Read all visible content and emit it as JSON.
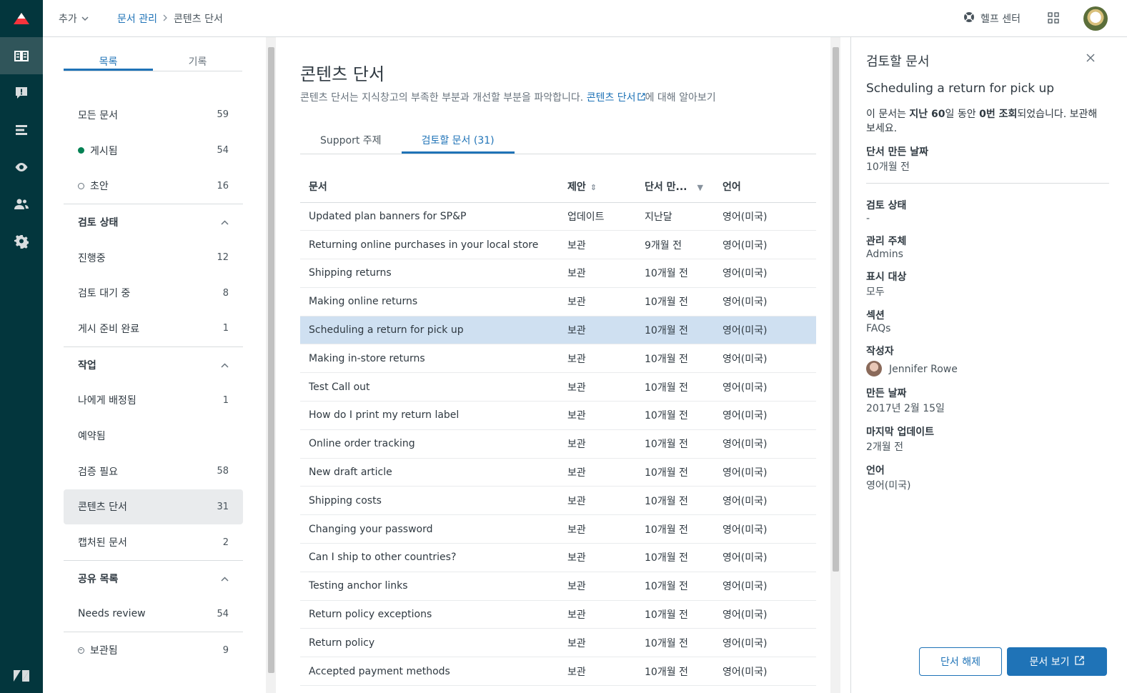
{
  "header": {
    "add_label": "추가",
    "breadcrumb": [
      "문서 관리",
      "콘텐츠 단서"
    ],
    "help_label": "헬프 센터"
  },
  "rail": {
    "icons": [
      "zendesk-guide-logo",
      "knowledge-icon",
      "alert-icon",
      "list-icon",
      "eye-icon",
      "users-icon",
      "gear-icon",
      "zendesk-logo"
    ]
  },
  "sidenav": {
    "tabs": [
      "목록",
      "기록"
    ],
    "top_items": [
      {
        "label": "모든 문서",
        "count": "59"
      },
      {
        "label": "게시됨",
        "count": "54"
      },
      {
        "label": "초안",
        "count": "16"
      }
    ],
    "review_head": "검토 상태",
    "review_items": [
      {
        "label": "진행중",
        "count": "12"
      },
      {
        "label": "검토 대기 중",
        "count": "8"
      },
      {
        "label": "게시 준비 완료",
        "count": "1"
      }
    ],
    "work_head": "작업",
    "work_items": [
      {
        "label": "나에게 배정됨",
        "count": "1"
      },
      {
        "label": "예약됨",
        "count": ""
      },
      {
        "label": "검증 필요",
        "count": "58"
      },
      {
        "label": "콘텐츠 단서",
        "count": "31"
      },
      {
        "label": "캡처된 문서",
        "count": "2"
      }
    ],
    "shared_head": "공유 목록",
    "shared_items": [
      {
        "label": "Needs review",
        "count": "54"
      }
    ],
    "archived": {
      "label": "보관됨",
      "count": "9"
    }
  },
  "main": {
    "title": "콘텐츠 단서",
    "desc_prefix": "콘텐츠 단서는 지식창고의 부족한 부분과 개선할 부분을 파악합니다.",
    "desc_link": "콘텐츠 단서",
    "desc_suffix": "에 대해 알아보기",
    "tabs": [
      "Support 주제",
      "검토할 문서 (31)"
    ],
    "columns": [
      "문서",
      "제안",
      "단서 만...",
      "언어"
    ],
    "rows": [
      [
        "Updated plan banners for SP&P",
        "업데이트",
        "지난달",
        "영어(미국)"
      ],
      [
        "Returning online purchases in your local store",
        "보관",
        "9개월 전",
        "영어(미국)"
      ],
      [
        "Shipping returns",
        "보관",
        "10개월 전",
        "영어(미국)"
      ],
      [
        "Making online returns",
        "보관",
        "10개월 전",
        "영어(미국)"
      ],
      [
        "Scheduling a return for pick up",
        "보관",
        "10개월 전",
        "영어(미국)"
      ],
      [
        "Making in-store returns",
        "보관",
        "10개월 전",
        "영어(미국)"
      ],
      [
        "Test Call out",
        "보관",
        "10개월 전",
        "영어(미국)"
      ],
      [
        "How do I print my return label",
        "보관",
        "10개월 전",
        "영어(미국)"
      ],
      [
        "Online order tracking",
        "보관",
        "10개월 전",
        "영어(미국)"
      ],
      [
        "New draft article",
        "보관",
        "10개월 전",
        "영어(미국)"
      ],
      [
        "Shipping costs",
        "보관",
        "10개월 전",
        "영어(미국)"
      ],
      [
        "Changing your password",
        "보관",
        "10개월 전",
        "영어(미국)"
      ],
      [
        "Can I ship to other countries?",
        "보관",
        "10개월 전",
        "영어(미국)"
      ],
      [
        "Testing anchor links",
        "보관",
        "10개월 전",
        "영어(미국)"
      ],
      [
        "Return policy exceptions",
        "보관",
        "10개월 전",
        "영어(미국)"
      ],
      [
        "Return policy",
        "보관",
        "10개월 전",
        "영어(미국)"
      ],
      [
        "Accepted payment methods",
        "보관",
        "10개월 전",
        "영어(미국)"
      ]
    ],
    "selected_row": 4
  },
  "panel": {
    "title": "검토할 문서",
    "subtitle": "Scheduling a return for pick up",
    "message_parts": [
      "이 문서는 ",
      "지난 60",
      "일 동안 ",
      "0번 조회",
      "되었습니다. 보관해 보세요."
    ],
    "fields_top": [
      {
        "k": "단서 만든 날짜",
        "v": "10개월 전"
      }
    ],
    "fields": [
      {
        "k": "검토 상태",
        "v": "-"
      },
      {
        "k": "관리 주체",
        "v": "Admins"
      },
      {
        "k": "표시 대상",
        "v": "모두"
      },
      {
        "k": "섹션",
        "v": "FAQs"
      }
    ],
    "author_label": "작성자",
    "author_name": "Jennifer Rowe",
    "fields_bottom": [
      {
        "k": "만든 날짜",
        "v": "2017년 2월 15일"
      },
      {
        "k": "마지막 업데이트",
        "v": "2개월 전"
      },
      {
        "k": "언어",
        "v": "영어(미국)"
      }
    ],
    "dismiss_label": "단서 해제",
    "view_label": "문서 보기"
  },
  "colors": {
    "rail": "#03363d",
    "accent": "#1f73b7",
    "highlight": "#cfe0f1",
    "published": "#038153"
  }
}
